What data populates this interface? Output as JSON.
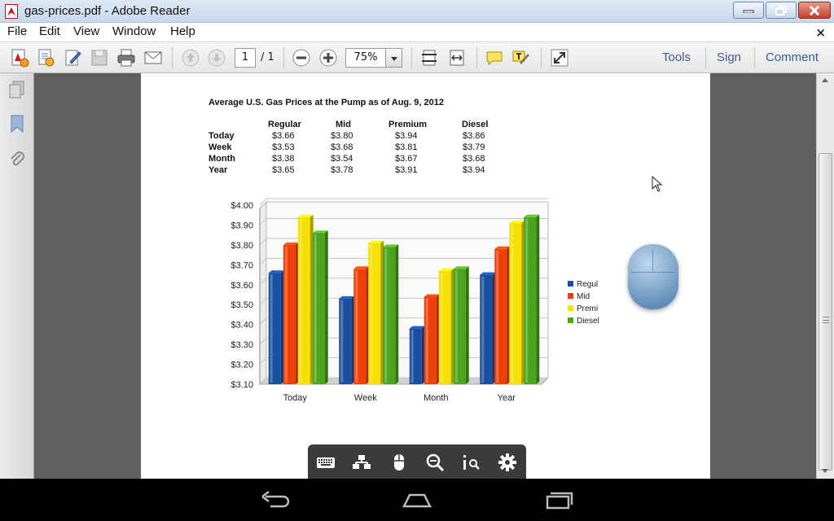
{
  "window": {
    "title": "gas-prices.pdf - Adobe Reader",
    "close_glyph": "×"
  },
  "menu": {
    "items": [
      "File",
      "Edit",
      "View",
      "Window",
      "Help"
    ],
    "close": "×"
  },
  "toolbar": {
    "page_current": "1",
    "page_total": "/ 1",
    "zoom": "75%",
    "tools_label": "Tools",
    "sign_label": "Sign",
    "comment_label": "Comment"
  },
  "document": {
    "title": "Average U.S. Gas Prices at the Pump as of Aug. 9, 2012",
    "table": {
      "columns": [
        "Regular",
        "Mid",
        "Premium",
        "Diesel"
      ],
      "rows": [
        {
          "label": "Today",
          "values": [
            "$3.66",
            "$3.80",
            "$3.94",
            "$3.86"
          ]
        },
        {
          "label": "Week",
          "values": [
            "$3.53",
            "$3.68",
            "$3.81",
            "$3.79"
          ]
        },
        {
          "label": "Month",
          "values": [
            "$3.38",
            "$3.54",
            "$3.67",
            "$3.68"
          ]
        },
        {
          "label": "Year",
          "values": [
            "$3.65",
            "$3.78",
            "$3.91",
            "$3.94"
          ]
        }
      ]
    }
  },
  "chart_data": {
    "type": "bar",
    "categories": [
      "Today",
      "Week",
      "Month",
      "Year"
    ],
    "series": [
      {
        "name": "Regular",
        "legend_label": "Regul",
        "color": "#1a4fa0",
        "values": [
          3.66,
          3.53,
          3.38,
          3.65
        ]
      },
      {
        "name": "Mid",
        "legend_label": "Mid",
        "color": "#f0400a",
        "values": [
          3.8,
          3.68,
          3.54,
          3.78
        ]
      },
      {
        "name": "Premium",
        "legend_label": "Premi",
        "color": "#f5e000",
        "values": [
          3.94,
          3.81,
          3.67,
          3.91
        ]
      },
      {
        "name": "Diesel",
        "legend_label": "Diesel",
        "color": "#4aa51c",
        "values": [
          3.86,
          3.79,
          3.68,
          3.94
        ]
      }
    ],
    "yticks": [
      "$3.10",
      "$3.20",
      "$3.30",
      "$3.40",
      "$3.50",
      "$3.60",
      "$3.70",
      "$3.80",
      "$3.90",
      "$4.00"
    ],
    "ylim": [
      3.1,
      4.0
    ],
    "grid": true,
    "legend_position": "right"
  }
}
